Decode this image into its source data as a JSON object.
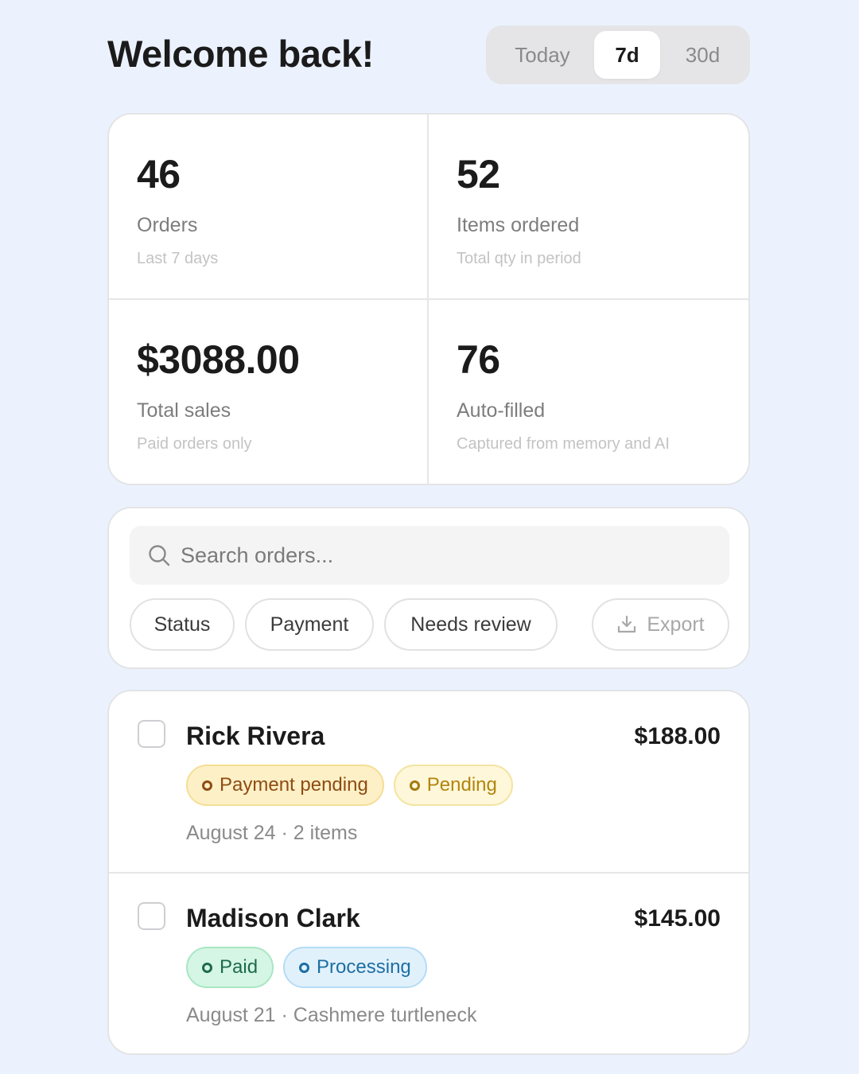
{
  "header": {
    "title": "Welcome back!",
    "range_options": [
      {
        "label": "Today",
        "selected": false
      },
      {
        "label": "7d",
        "selected": true
      },
      {
        "label": "30d",
        "selected": false
      }
    ]
  },
  "stats": [
    {
      "value": "46",
      "label": "Orders",
      "sub": "Last 7 days"
    },
    {
      "value": "52",
      "label": "Items ordered",
      "sub": "Total qty in period"
    },
    {
      "value": "$3088.00",
      "label": "Total sales",
      "sub": "Paid orders only"
    },
    {
      "value": "76",
      "label": "Auto-filled",
      "sub": "Captured from memory and AI"
    }
  ],
  "search": {
    "placeholder": "Search orders...",
    "value": "",
    "icon": "search-icon"
  },
  "filters": {
    "status_label": "Status",
    "payment_label": "Payment",
    "review_label": "Needs review",
    "export_label": "Export",
    "export_icon": "download-icon"
  },
  "orders": [
    {
      "name": "Rick Rivera",
      "amount": "$188.00",
      "badges": [
        {
          "label": "Payment pending",
          "tone": "amber"
        },
        {
          "label": "Pending",
          "tone": "yellow"
        }
      ],
      "meta": "August 24 · 2 items",
      "checked": false
    },
    {
      "name": "Madison Clark",
      "amount": "$145.00",
      "badges": [
        {
          "label": "Paid",
          "tone": "green"
        },
        {
          "label": "Processing",
          "tone": "blue"
        }
      ],
      "meta": "August 21 · Cashmere turtleneck",
      "checked": false
    }
  ],
  "colors": {
    "background": "#ebf2fe",
    "card": "#ffffff",
    "amber": "#8e4c12",
    "yellow": "#b2850e",
    "green": "#1d6a4a",
    "blue": "#1e6ea2"
  }
}
